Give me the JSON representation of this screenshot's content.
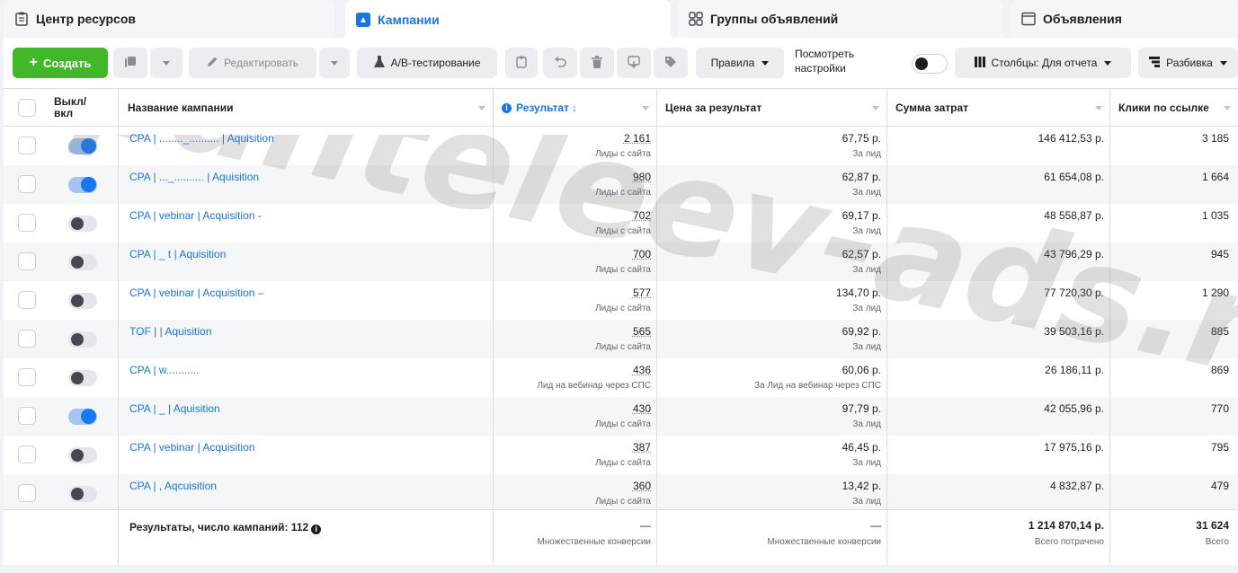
{
  "tabs": [
    {
      "label": "Центр ресурсов",
      "icon": "clipboard-icon"
    },
    {
      "label": "Кампании",
      "icon": "flag-icon"
    },
    {
      "label": "Группы объявлений",
      "icon": "grid-icon"
    },
    {
      "label": "Объявления",
      "icon": "window-icon"
    }
  ],
  "toolbar": {
    "create": "Создать",
    "edit": "Редактировать",
    "ab_test": "А/В-тестирование",
    "rules": "Правила",
    "view_settings_line1": "Посмотреть",
    "view_settings_line2": "настройки",
    "columns": "Столбцы: Для отчета",
    "breakdown": "Разбивка"
  },
  "table": {
    "headers": {
      "onoff_line1": "Выкл/",
      "onoff_line2": "вкл",
      "name": "Название кампании",
      "result": "Результат",
      "cost_per_result": "Цена за результат",
      "amount_spent": "Сумма затрат",
      "link_clicks": "Клики по ссылке"
    },
    "rows": [
      {
        "name": "CPA | ........_.......... | Aquisition",
        "on": true,
        "result": "2 161",
        "result_sub": "Лиды с сайта",
        "cost": "67,75 р.",
        "cost_sub": "За лид",
        "spent": "146 412,53 р.",
        "clicks": "3 185"
      },
      {
        "name": "CPA | ..._.......... | Aquisition",
        "on": true,
        "result": "980",
        "result_sub": "Лиды с сайта",
        "cost": "62,87 р.",
        "cost_sub": "За лид",
        "spent": "61 654,08 р.",
        "clicks": "1 664"
      },
      {
        "name": "CPA | vebinar | Acquisition -",
        "on": false,
        "result": "702",
        "result_sub": "Лиды с сайта",
        "cost": "69,17 р.",
        "cost_sub": "За лид",
        "spent": "48 558,87 р.",
        "clicks": "1 035"
      },
      {
        "name": "CPA |                _          t | Aquisition",
        "on": false,
        "result": "700",
        "result_sub": "Лиды с сайта",
        "cost": "62,57 р.",
        "cost_sub": "За лид",
        "spent": "43 796,29 р.",
        "clicks": "945"
      },
      {
        "name": "CPA | vebinar | Acquisition –",
        "on": false,
        "result": "577",
        "result_sub": "Лиды с сайта",
        "cost": "134,70 р.",
        "cost_sub": "За лид",
        "spent": "77 720,30 р.",
        "clicks": "1 290"
      },
      {
        "name": "TOF |                  | Aquisition",
        "on": false,
        "result": "565",
        "result_sub": "Лиды с сайта",
        "cost": "69,92 р.",
        "cost_sub": "За лид",
        "spent": "39 503,16 р.",
        "clicks": "885"
      },
      {
        "name": "CPA | w...........",
        "on": false,
        "result": "436",
        "result_sub": "Лид на вебинар через СПС",
        "cost": "60,06 р.",
        "cost_sub": "За Лид на вебинар через СПС",
        "spent": "26 186,11 р.",
        "clicks": "869"
      },
      {
        "name": "CPA |                 _          | Aquisition",
        "on": true,
        "result": "430",
        "result_sub": "Лиды с сайта",
        "cost": "97,79 р.",
        "cost_sub": "За лид",
        "spent": "42 055,96 р.",
        "clicks": "770"
      },
      {
        "name": "CPA | vebinar | Acquisition",
        "on": false,
        "result": "387",
        "result_sub": "Лиды с сайта",
        "cost": "46,45 р.",
        "cost_sub": "За лид",
        "spent": "17 975,16 р.",
        "clicks": "795"
      },
      {
        "name": "CPA |                  , Aqcuisition",
        "on": false,
        "result": "360",
        "result_sub": "Лиды с сайта",
        "cost": "13,42 р.",
        "cost_sub": "За лид",
        "spent": "4 832,87 р.",
        "clicks": "479"
      }
    ],
    "footer": {
      "title": "Результаты, число кампаний: 112",
      "result": "—",
      "result_sub": "Множественные конверсии",
      "cost": "—",
      "cost_sub": "Множественные конверсии",
      "spent": "1 214 870,14 р.",
      "spent_sub": "Всего потрачено",
      "clicks": "31 624",
      "clicks_sub": "Всего"
    }
  },
  "watermark": "panteleev-ads.ru",
  "colors": {
    "accent": "#1b74e4",
    "create_green": "#42b72a",
    "toggle_on": "#1877f2"
  }
}
